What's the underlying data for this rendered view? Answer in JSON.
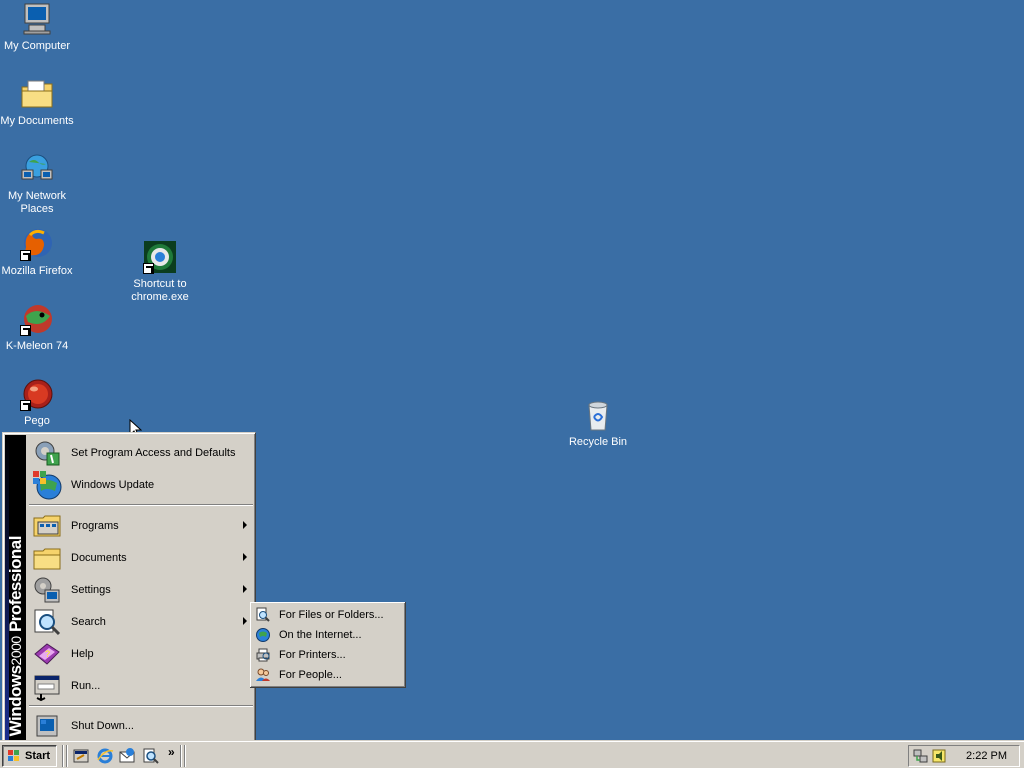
{
  "desktop": {
    "icons": [
      {
        "label": "My Computer",
        "icon": "computer-icon"
      },
      {
        "label": "My Documents",
        "icon": "folder-documents-icon"
      },
      {
        "label": "My Network Places",
        "icon": "network-icon"
      },
      {
        "label": "Mozilla Firefox",
        "icon": "firefox-icon"
      },
      {
        "label": "K-Meleon 74",
        "icon": "kmeleon-icon"
      },
      {
        "label": "Pego",
        "icon": "pego-icon"
      },
      {
        "label": "Shortcut to chrome.exe",
        "icon": "chrome-icon"
      },
      {
        "label": "Recycle Bin",
        "icon": "recycle-bin-icon"
      }
    ]
  },
  "start_menu": {
    "banner_bold": "Windows",
    "banner_thin": "2000",
    "banner_bold2": "Professional",
    "items": [
      {
        "label": "Set Program Access and Defaults",
        "icon": "program-access-icon",
        "submenu": false
      },
      {
        "label": "Windows Update",
        "icon": "windows-update-icon",
        "submenu": false
      },
      {
        "label": "Programs",
        "icon": "programs-icon",
        "submenu": true
      },
      {
        "label": "Documents",
        "icon": "documents-icon",
        "submenu": true
      },
      {
        "label": "Settings",
        "icon": "settings-icon",
        "submenu": true
      },
      {
        "label": "Search",
        "icon": "search-icon",
        "submenu": true
      },
      {
        "label": "Help",
        "icon": "help-icon",
        "submenu": false
      },
      {
        "label": "Run...",
        "icon": "run-icon",
        "submenu": false
      },
      {
        "label": "Shut Down...",
        "icon": "shutdown-icon",
        "submenu": false
      }
    ]
  },
  "search_submenu": {
    "items": [
      {
        "label": "For Files or Folders...",
        "icon": "find-files-icon"
      },
      {
        "label": "On the Internet...",
        "icon": "internet-globe-icon"
      },
      {
        "label": "For Printers...",
        "icon": "printer-icon"
      },
      {
        "label": "For People...",
        "icon": "people-icon"
      }
    ]
  },
  "taskbar": {
    "start_label": "Start",
    "quick_launch": [
      "show-desktop-icon",
      "internet-explorer-icon",
      "outlook-express-icon",
      "search-icon"
    ],
    "more_label": "»",
    "tray_icons": [
      "network-tray-icon",
      "volume-tray-icon"
    ],
    "clock": "2:22 PM"
  },
  "colors": {
    "desktop_bg": "#3a6ea5",
    "menu_bg": "#d4d0c8",
    "banner_bg": "#000000"
  }
}
